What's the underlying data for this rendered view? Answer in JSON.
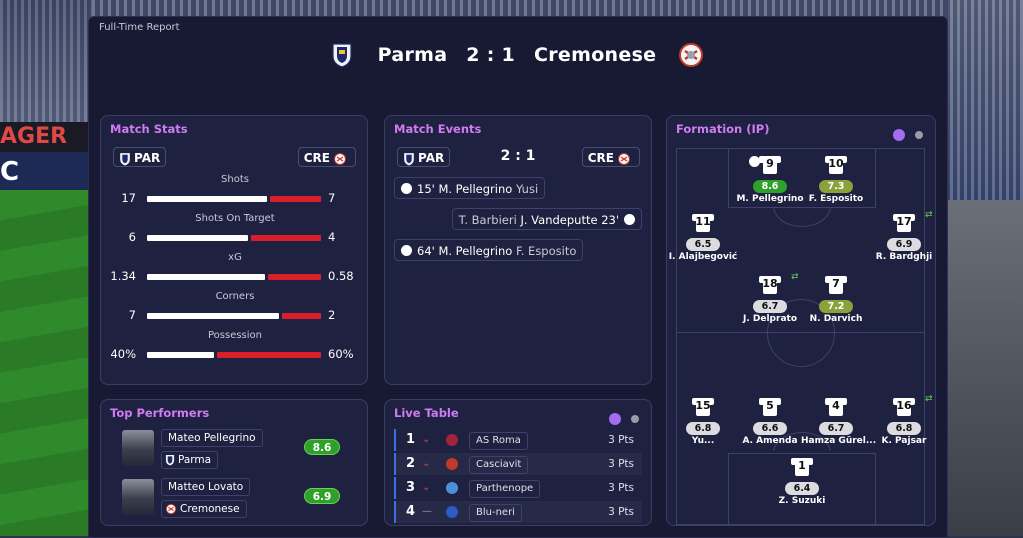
{
  "header": {
    "title": "Full-Time Report",
    "home": "Parma",
    "score": "2 : 1",
    "away": "Cremonese"
  },
  "background": {
    "board1": "AGER",
    "board2": "C"
  },
  "match_stats": {
    "title": "Match Stats",
    "home_abbr": "PAR",
    "away_abbr": "CRE",
    "rows": [
      {
        "label": "Shots",
        "home": "17",
        "away": "7",
        "home_share": 0.708
      },
      {
        "label": "Shots On Target",
        "home": "6",
        "away": "4",
        "home_share": 0.6
      },
      {
        "label": "xG",
        "home": "1.34",
        "away": "0.58",
        "home_share": 0.698
      },
      {
        "label": "Corners",
        "home": "7",
        "away": "2",
        "home_share": 0.778
      },
      {
        "label": "Possession",
        "home": "40%",
        "away": "60%",
        "home_share": 0.4
      }
    ]
  },
  "match_events": {
    "title": "Match Events",
    "home_abbr": "PAR",
    "away_abbr": "CRE",
    "score": "2 : 1",
    "events": [
      {
        "side": "home",
        "minute": "15'",
        "scorer": "M. Pellegrino",
        "assist": "Yusi"
      },
      {
        "side": "away",
        "minute": "23'",
        "scorer": "J. Vandeputte",
        "assist": "T. Barbieri"
      },
      {
        "side": "home",
        "minute": "64'",
        "scorer": "M. Pellegrino",
        "assist": "F. Esposito"
      }
    ]
  },
  "top_performers": {
    "title": "Top Performers",
    "players": [
      {
        "name": "Mateo Pellegrino",
        "team": "Parma",
        "rating": "8.6"
      },
      {
        "name": "Matteo Lovato",
        "team": "Cremonese",
        "rating": "6.9"
      }
    ]
  },
  "live_table": {
    "title": "Live Table",
    "rows": [
      {
        "pos": "1",
        "trend": "down",
        "arrow": "⌄",
        "team": "AS Roma",
        "pts": "3 Pts",
        "crest_color": "#a3243a"
      },
      {
        "pos": "2",
        "trend": "down",
        "arrow": "⌄",
        "team": "Casciavit",
        "pts": "3 Pts",
        "crest_color": "#c0392b"
      },
      {
        "pos": "3",
        "trend": "down",
        "arrow": "⌄",
        "team": "Parthenope",
        "pts": "3 Pts",
        "crest_color": "#4a90d9"
      },
      {
        "pos": "4",
        "trend": "same",
        "arrow": "—",
        "team": "Blu-neri",
        "pts": "3 Pts",
        "crest_color": "#2b5cc4"
      }
    ]
  },
  "formation": {
    "title": "Formation (IP)",
    "players": [
      {
        "num": "9",
        "rating": "8.6",
        "name": "M. Pellegrino",
        "style": "green",
        "goal": true
      },
      {
        "num": "10",
        "rating": "7.3",
        "name": "F. Esposito",
        "style": "olive"
      },
      {
        "num": "11",
        "rating": "6.5",
        "name": "I. Alajbegović",
        "style": "grey"
      },
      {
        "num": "17",
        "rating": "6.9",
        "name": "R. Bardghji",
        "style": "grey",
        "sub": true
      },
      {
        "num": "18",
        "rating": "6.7",
        "name": "J. Delprato",
        "style": "grey",
        "sub": true
      },
      {
        "num": "7",
        "rating": "7.2",
        "name": "N. Darvich",
        "style": "olive"
      },
      {
        "num": "15",
        "rating": "6.8",
        "name": "Yu...",
        "style": "grey"
      },
      {
        "num": "5",
        "rating": "6.6",
        "name": "A. Amenda",
        "style": "grey"
      },
      {
        "num": "4",
        "rating": "6.7",
        "name": "Hamza Gürel...",
        "style": "grey"
      },
      {
        "num": "16",
        "rating": "6.8",
        "name": "K. Pajsar",
        "style": "grey",
        "sub": true
      },
      {
        "num": "1",
        "rating": "6.4",
        "name": "Z. Suzuki",
        "style": "grey"
      }
    ]
  },
  "colors": {
    "accent": "#cf7cf2",
    "home_bar": "#ffffff",
    "away_bar": "#d91f2b",
    "rating_green": "#2fa12b",
    "dot_purple": "#a46cf0",
    "dot_grey": "#9a9aaa"
  }
}
